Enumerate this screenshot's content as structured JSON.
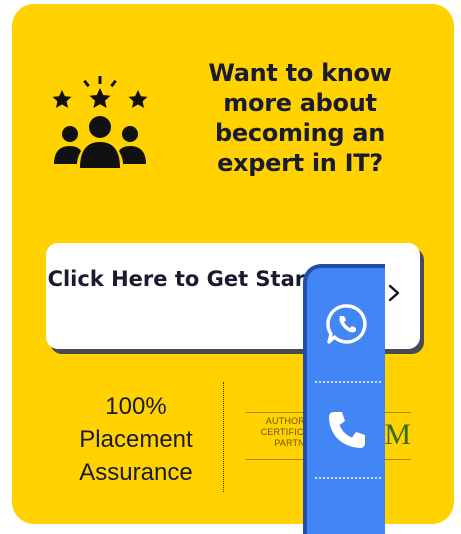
{
  "promo": {
    "icon": "rated-team-icon",
    "headline": "Want to know more about becoming an expert in IT?",
    "cta_label": "Click Here to Get Started",
    "cta_icon": "chevron-right-icon",
    "assurance": "100% Placement Assurance",
    "badge_text": "AUTHORIZED CERTIFICATION PARTNER",
    "badge_logo": "M"
  },
  "contact": {
    "whatsapp_icon": "whatsapp-icon",
    "phone_icon": "phone-icon",
    "bar_color": "#4285F4"
  },
  "colors": {
    "card": "#FFD200",
    "text": "#1a1b2e"
  }
}
